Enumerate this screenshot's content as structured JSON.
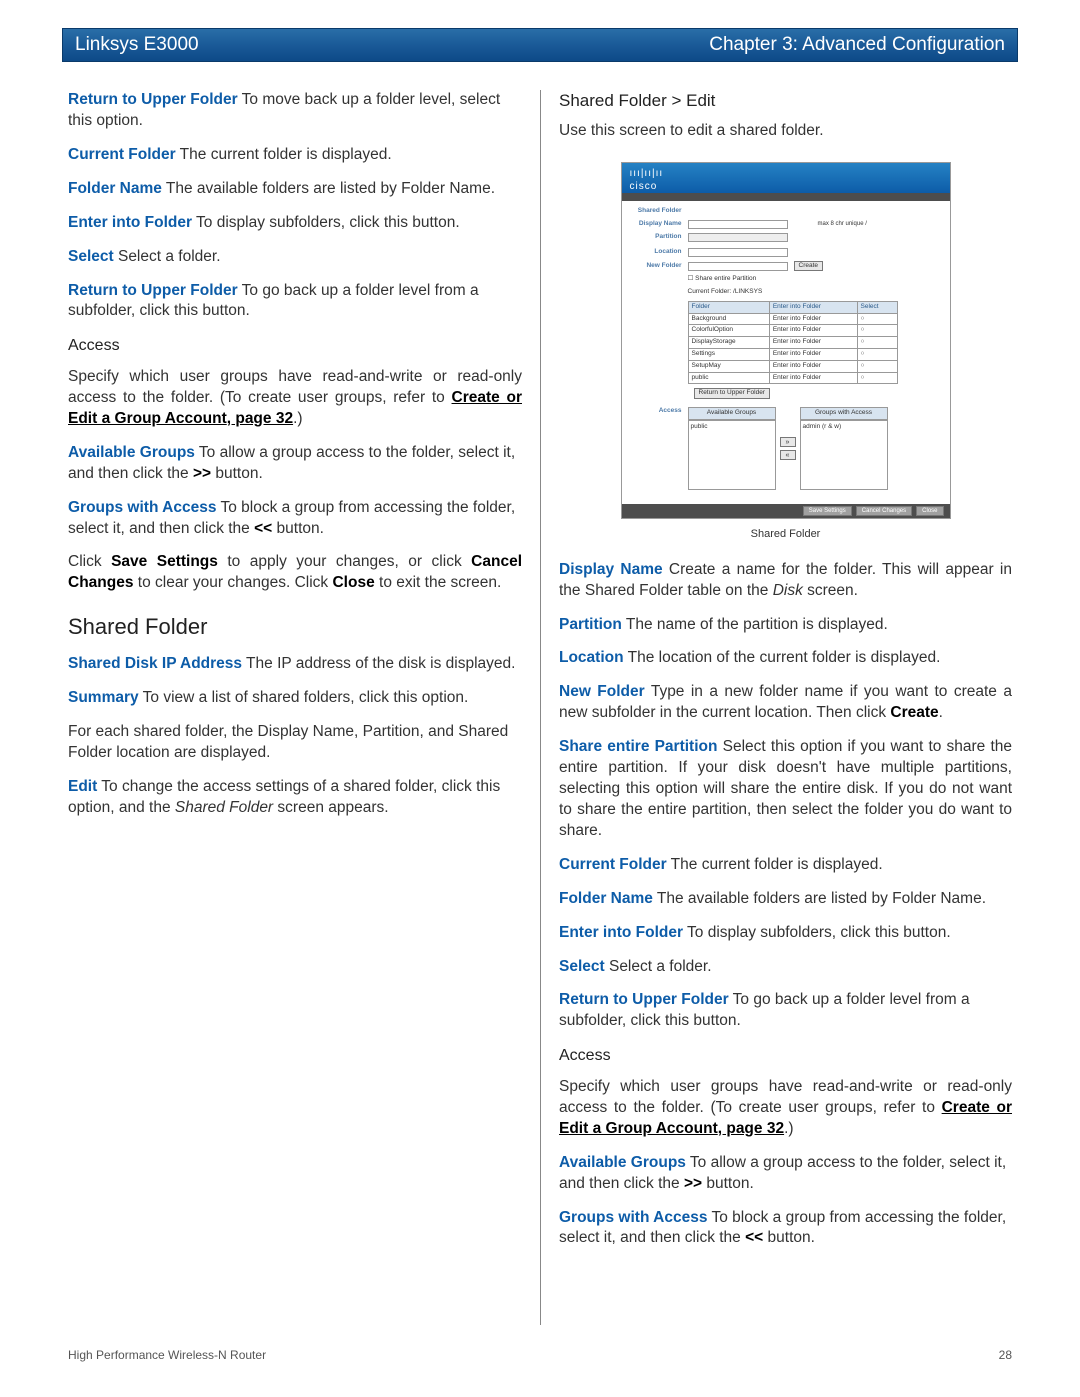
{
  "header": {
    "left": "Linksys E3000",
    "right": "Chapter 3: Advanced Configuration"
  },
  "footer": {
    "left": "High Performance Wireless-N Router",
    "right": "28"
  },
  "left_col": {
    "p1_term": "Return to Upper Folder",
    "p1_rest": "  To move back up a folder level, select this option.",
    "p2_term": "Current Folder",
    "p2_rest": "  The current folder is displayed.",
    "p3_term": "Folder Name",
    "p3_rest": "  The available folders are listed by Folder Name.",
    "p4_term": "Enter into Folder",
    "p4_rest": "  To display subfolders, click this button.",
    "p5_term": "Select",
    "p5_rest": "  Select a folder.",
    "p6_term": "Return to Upper Folder",
    "p6_rest": "  To go back up a folder level from a subfolder, click this button.",
    "h_access": "Access",
    "p7": "Specify which user groups have read-and-write or read-only access to the folder. (To create user groups, refer to ",
    "p7_link": "Create or Edit a Group Account",
    "p7_page": ", page 32",
    "p7_end": ".)",
    "p8_term": "Available Groups",
    "p8_rest": "  To allow a group access to the folder, select it, and then click the ",
    "p8_b": ">>",
    "p8_end": " button.",
    "p9_term": "Groups with Access",
    "p9_rest": "  To block a group from accessing the folder, select it, and then click the ",
    "p9_b": "<<",
    "p9_end": " button.",
    "p10_a": "Click ",
    "p10_b1": "Save Settings",
    "p10_b": " to apply your changes, or click ",
    "p10_b2": "Cancel Changes",
    "p10_c": " to clear your changes. Click ",
    "p10_b3": "Close",
    "p10_d": " to exit the screen.",
    "h_shared": "Shared Folder",
    "p11_term": "Shared Disk IP Address",
    "p11_rest": "  The IP address of the disk is displayed.",
    "p12_term": "Summary",
    "p12_rest": "  To view a list of shared folders, click this option.",
    "p13": "For each shared folder, the Display Name, Partition, and Shared Folder location are displayed.",
    "p14_term": "Edit",
    "p14_rest": "  To change the access settings of a shared folder, click this option, and the ",
    "p14_i": "Shared Folder",
    "p14_end": " screen appears."
  },
  "right_col": {
    "h_edit": "Shared Folder > Edit",
    "p_intro": "Use this screen to edit a shared folder.",
    "caption": "Shared Folder",
    "p1_term": "Display Name",
    "p1_rest": "  Create a name for the folder. This will appear in the Shared Folder table on the ",
    "p1_i": "Disk",
    "p1_end": " screen.",
    "p2_term": "Partition",
    "p2_rest": "  The name of the partition is displayed.",
    "p3_term": "Location",
    "p3_rest": "  The location of the current folder is displayed.",
    "p4_term": "New Folder",
    "p4_rest": "  Type in a new folder name if you want to create a new subfolder in the current location. Then click ",
    "p4_b": "Create",
    "p4_end": ".",
    "p5_term": "Share entire Partition",
    "p5_rest": "  Select this option if you want to share the entire partition. If your disk doesn't have multiple partitions, selecting this option will share the entire disk. If you do not want to share the entire partition, then select the folder you do want to share.",
    "p6_term": "Current Folder",
    "p6_rest": "  The current folder is displayed.",
    "p7_term": "Folder Name",
    "p7_rest": "  The available folders are listed by Folder Name.",
    "p8_term": "Enter into Folder",
    "p8_rest": "  To display subfolders, click this button.",
    "p9_term": "Select",
    "p9_rest": "  Select a folder.",
    "p10_term": "Return to Upper Folder",
    "p10_rest": "  To go back up a folder level from a subfolder, click this button.",
    "h_access": "Access",
    "p11": "Specify which user groups have read-and-write or read-only access to the folder. (To create user groups, refer to ",
    "p11_link": "Create or Edit a Group Account",
    "p11_page": ", page 32",
    "p11_end": ".)",
    "p12_term": "Available Groups",
    "p12_rest": "  To allow a group access to the folder, select it, and then click the ",
    "p12_b": ">>",
    "p12_end": " button.",
    "p13_term": "Groups with Access",
    "p13_rest": "  To block a group from accessing the folder, select it, and then click the ",
    "p13_b": "<<",
    "p13_end": " button."
  },
  "fig": {
    "brand": "cisco",
    "labels": {
      "shared_folder": "Shared Folder",
      "display_name": "Display Name",
      "partition": "Partition",
      "location": "Location",
      "new_folder": "New Folder",
      "access": "Access"
    },
    "hint": "max 8 chr unique /",
    "create": "Create",
    "share_chk": "Share entire Partition",
    "curr": "Current Folder: /LINKSYS",
    "th": {
      "folder": "Folder",
      "enter": "Enter into Folder",
      "select": "Select"
    },
    "rows": [
      "Background",
      "ColorfulOption",
      "DisplayStorage",
      "Settings",
      "SetupMay",
      "public"
    ],
    "enter": "Enter into Folder",
    "return": "Return to Upper Folder",
    "avail": "Available Groups",
    "with": "Groups with Access",
    "g1": "public",
    "g2": "admin (r & w)",
    "btns": {
      "save": "Save Settings",
      "cancel": "Cancel Changes",
      "close": "Close"
    }
  }
}
